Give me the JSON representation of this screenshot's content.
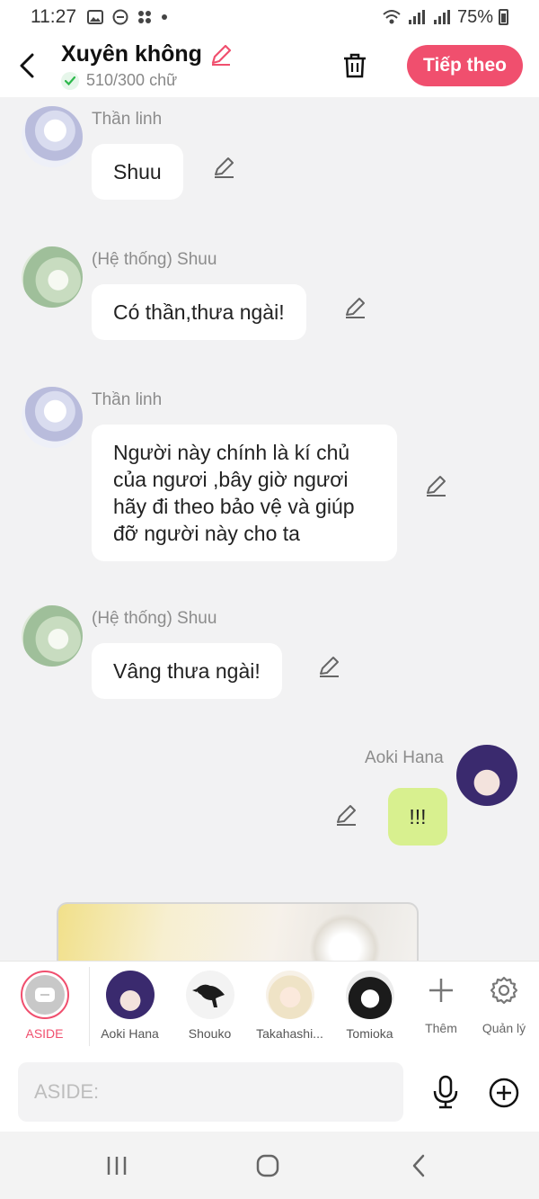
{
  "status_bar": {
    "time": "11:27",
    "battery": "75%"
  },
  "header": {
    "title": "Xuyên không",
    "word_count": "510/300 chữ",
    "next_button": "Tiếp theo"
  },
  "messages": [
    {
      "sender": "Thần linh",
      "text": "Shuu",
      "avatar": "god-avatar"
    },
    {
      "sender": "(Hệ thống) Shuu",
      "text": "Có thần,thưa ngài!",
      "avatar": "system-avatar"
    },
    {
      "sender": "Thần linh",
      "text": "Người này chính là kí chủ của ngươi ,bây giờ ngươi hãy đi theo bảo vệ và giúp đỡ người này cho ta",
      "avatar": "god-avatar"
    },
    {
      "sender": "(Hệ thống) Shuu",
      "text": "Vâng thưa ngài!",
      "avatar": "system-avatar"
    },
    {
      "sender": "Aoki Hana",
      "text": "!!!",
      "avatar": "aoki-avatar"
    }
  ],
  "characters": {
    "aside_label": "ASIDE",
    "items": [
      {
        "label": "Aoki Hana"
      },
      {
        "label": "Shouko"
      },
      {
        "label": "Takahashi..."
      },
      {
        "label": "Tomioka"
      }
    ],
    "add_label": "Thêm",
    "manage_label": "Quản lý"
  },
  "input": {
    "placeholder": "ASIDE:"
  },
  "colors": {
    "accent": "#f04f6e",
    "my_bubble": "#d8f08f",
    "background": "#f2f2f3"
  }
}
